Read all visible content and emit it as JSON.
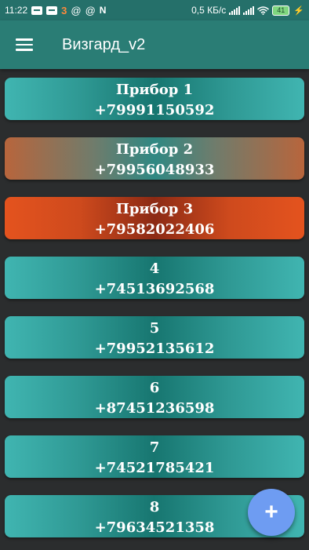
{
  "status_bar": {
    "time": "11:22",
    "speed": "0,5 КБ/с",
    "battery_level": "41",
    "icons": [
      "chat-icon",
      "chat-icon",
      "app-3-icon",
      "at-icon",
      "at-icon",
      "n-icon",
      "signal-icon",
      "signal-icon",
      "wifi-icon",
      "battery-icon",
      "charging-icon"
    ]
  },
  "app_bar": {
    "title": "Визгард_v2",
    "menu_icon": "hamburger-menu-icon"
  },
  "devices": [
    {
      "name": "Прибор 1",
      "phone": "+79991150592",
      "style": "teal"
    },
    {
      "name": "Прибор 2",
      "phone": "+79956048933",
      "style": "amber"
    },
    {
      "name": "Прибор 3",
      "phone": "+79582022406",
      "style": "red"
    },
    {
      "name": "4",
      "phone": "+74513692568",
      "style": "teal"
    },
    {
      "name": "5",
      "phone": "+79952135612",
      "style": "teal"
    },
    {
      "name": "6",
      "phone": "+87451236598",
      "style": "teal"
    },
    {
      "name": "7",
      "phone": "+74521785421",
      "style": "teal"
    },
    {
      "name": "8",
      "phone": "+79634521358",
      "style": "teal"
    }
  ],
  "fab": {
    "label": "+",
    "icon": "add-icon"
  },
  "colors": {
    "status_bar": "#25706a",
    "app_bar": "#2a7d75",
    "background": "#2b2d2e",
    "card_teal": "#40b5b1",
    "card_amber": "#b8653c",
    "card_red": "#e4531e",
    "fab": "#6e9cf2"
  }
}
